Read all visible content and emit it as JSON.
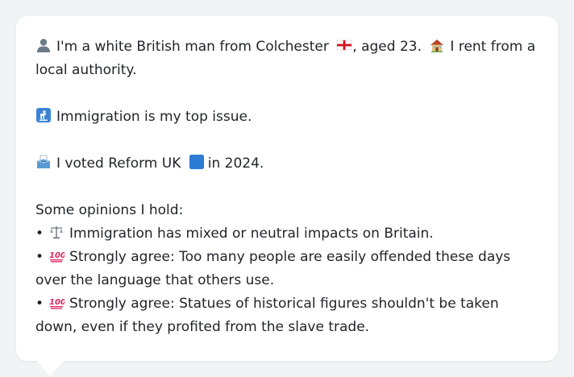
{
  "profile": {
    "intro_text": "I'm a white British man from Colchester",
    "flag_icon": "england-flag-icon",
    "age_text": ", aged 23.",
    "house_icon": "house-icon",
    "housing_text": "I rent from a local authority."
  },
  "issue": {
    "icon": "passport-control-icon",
    "text": "Immigration is my top issue."
  },
  "vote": {
    "icon": "ballot-box-icon",
    "text_prefix": "I voted Reform UK",
    "party_color_icon": "blue-square-icon",
    "party_color": "#2b7cd3",
    "text_suffix": "in 2024."
  },
  "opinions": {
    "heading": "Some opinions I hold:",
    "items": [
      {
        "icon": "balance-scale-icon",
        "text": "Immigration has mixed or neutral impacts on Britain."
      },
      {
        "icon": "hundred-points-icon",
        "text": "Strongly agree: Too many people are easily offended these days over the language that others use."
      },
      {
        "icon": "hundred-points-icon",
        "text": "Strongly agree: Statues of historical figures shouldn't be taken down, even if they profited from the slave trade."
      }
    ]
  }
}
